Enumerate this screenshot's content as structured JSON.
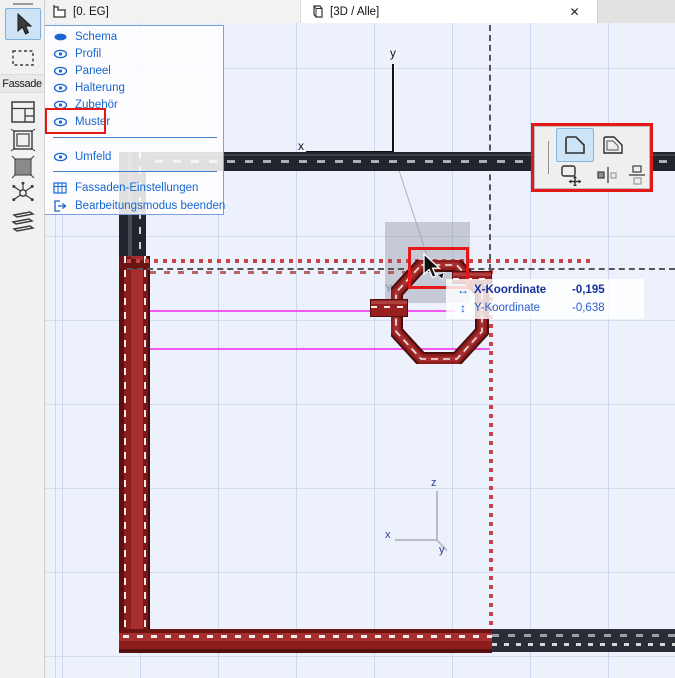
{
  "window": {
    "tabs": [
      {
        "label": "[0. EG]",
        "icon": "floor-plan-icon"
      },
      {
        "label": "[3D / Alle]",
        "icon": "3d-view-icon",
        "close_glyph": "✕"
      }
    ]
  },
  "sidebar": {
    "group_label": "Fassade",
    "tools": [
      "arrow-tool",
      "marquee-tool",
      "scheme-tool",
      "frame-tool",
      "panel-tool",
      "node-tool",
      "junction-tool"
    ]
  },
  "context_menu": {
    "items": [
      {
        "label": "Schema",
        "icon": "eye-closed"
      },
      {
        "label": "Profil",
        "icon": "eye"
      },
      {
        "label": "Paneel",
        "icon": "eye"
      },
      {
        "label": "Halterung",
        "icon": "eye"
      },
      {
        "label": "Zubehör",
        "icon": "eye"
      },
      {
        "label": "Muster",
        "icon": "eye",
        "highlighted": true
      },
      {
        "label": "Umfeld",
        "icon": "eye"
      },
      {
        "label": "Fassaden-Einstellungen",
        "icon": "settings-table"
      },
      {
        "label": "Bearbeitungsmodus beenden",
        "icon": "exit"
      }
    ]
  },
  "tracker": {
    "x_arrow": "↔",
    "x_label": "X-Koordinate",
    "x_value": "-0,195",
    "y_arrow": "↕",
    "y_label": "Y-Koordinate",
    "y_value": "-0,638"
  },
  "axes": {
    "top": {
      "x_label": "x",
      "y_label": "y"
    },
    "mini": {
      "x_label": "x",
      "y_label": "y",
      "z_label": "z"
    },
    "ghost_label": "Y"
  },
  "colors": {
    "highlight_red": "#e51717",
    "member_red": "#9c2222",
    "beam_dark": "#23252e",
    "magenta": "#f63cf0",
    "selection_dot_red": "#c64545",
    "menu_blue": "#1666d0",
    "tracker_primary": "#16309d",
    "tracker_secondary": "#2a5fd0",
    "palette_selected_bg": "#cde4f6"
  }
}
